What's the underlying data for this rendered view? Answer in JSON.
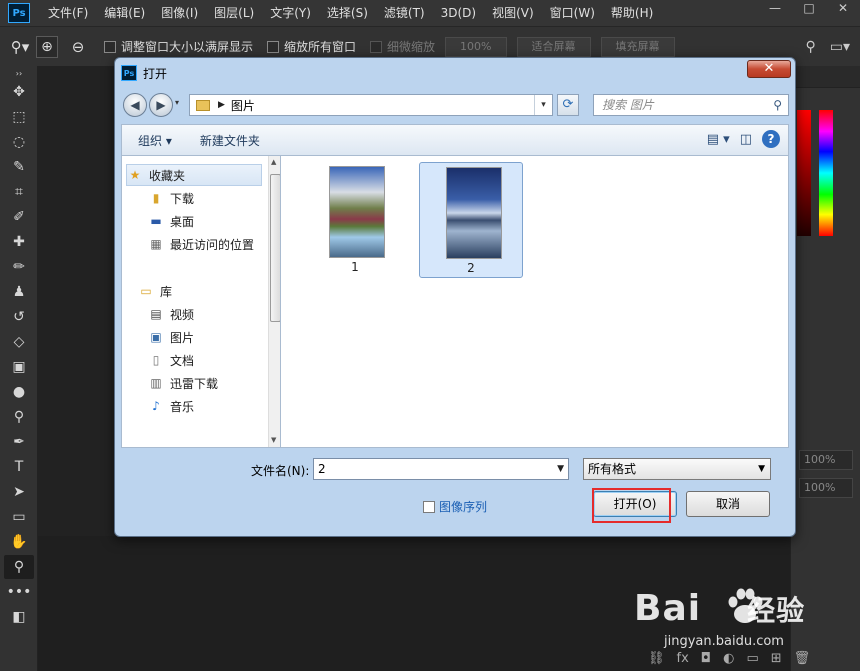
{
  "app": {
    "logo": "Ps",
    "menu": [
      "文件(F)",
      "编辑(E)",
      "图像(I)",
      "图层(L)",
      "文字(Y)",
      "选择(S)",
      "滤镜(T)",
      "3D(D)",
      "视图(V)",
      "窗口(W)",
      "帮助(H)"
    ],
    "window_controls": [
      "—",
      "□",
      "✕"
    ]
  },
  "options": {
    "resize_windows": "调整窗口大小以满屏显示",
    "zoom_all": "缩放所有窗口",
    "scrubby_zoom": "细微缩放",
    "zoom_value": "100%",
    "fit_screen": "适合屏幕",
    "fill_screen": "填充屏幕"
  },
  "right_panel": {
    "pct_1": "100%",
    "pct_2": "100%"
  },
  "dialog": {
    "title": "打开",
    "address": "图片",
    "search_placeholder": "搜索 图片",
    "commands": {
      "organize": "组织 ▾",
      "new_folder": "新建文件夹"
    },
    "nav": {
      "favorites": "收藏夹",
      "downloads": "下载",
      "desktop": "桌面",
      "recent": "最近访问的位置",
      "library": "库",
      "videos": "视频",
      "pictures": "图片",
      "documents": "文档",
      "xunlei": "迅雷下载",
      "music": "音乐"
    },
    "files": [
      {
        "name": "1",
        "selected": false
      },
      {
        "name": "2",
        "selected": true
      }
    ],
    "filename_label": "文件名(N):",
    "filename_value": "2",
    "filetype": "所有格式",
    "sequence": "图像序列",
    "open_button": "打开(O)",
    "cancel_button": "取消"
  },
  "watermark": {
    "logo": "Bai",
    "logo_cn": "经验",
    "url": "jingyan.baidu.com"
  },
  "colors": {
    "highlight_box": "#e52b2b",
    "dialog_frame": "#bcd4ee"
  }
}
